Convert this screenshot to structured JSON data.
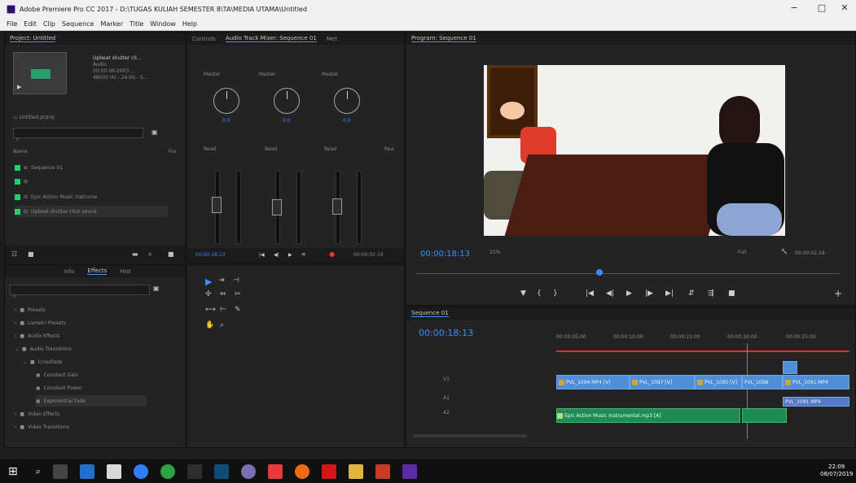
{
  "window": {
    "title": "Adobe Premiere Pro CC 2017 - D:\\TUGAS KULIAH SEMESTER 8\\TA\\MEDIA UTAMA\\Untitled",
    "minimize": "−",
    "maximize": "□",
    "close": "✕"
  },
  "menu": [
    "File",
    "Edit",
    "Clip",
    "Sequence",
    "Marker",
    "Title",
    "Window",
    "Help"
  ],
  "project": {
    "tab": "Project: Untitled",
    "clip_name": "Upbeat shutter cli...",
    "clip_type": "Audio",
    "clip_duration": "00:00:06:2003 ...",
    "clip_rate": "48000 Hz - 24 bit - S...",
    "project_file": "Untitled.prproj",
    "header_name": "Name",
    "header_fps": "Fra",
    "items": [
      "Sequence 01",
      "",
      "Epic Action Music Instrume",
      "Upbeat shutter click sound"
    ]
  },
  "mixer": {
    "tabs": [
      "Controls",
      "Audio Track Mixer: Sequence 01",
      "Met"
    ],
    "track_labels": [
      "Master",
      "Master",
      "Master"
    ],
    "read_labels": [
      "Read",
      "Read",
      "Read",
      "Rea"
    ],
    "knob_values": [
      "0.0",
      "0.0",
      "0.0"
    ],
    "time_left": "00:00:18:13",
    "time_right": "00:00:02:19"
  },
  "effects": {
    "tabs": [
      "Info",
      "Effects",
      "Hist"
    ],
    "search_placeholder": "",
    "folders": [
      "Presets",
      "Lumetri Presets",
      "Audio Effects",
      "Audio Transitions",
      "Crossfade",
      "Constant Gain",
      "Constant Power",
      "Exponential Fade",
      "Video Effects",
      "Video Transitions"
    ]
  },
  "program": {
    "tab": "Program: Sequence 01",
    "timecode": "00:00:18:13",
    "zoom": "25%",
    "quality": "Full",
    "duration": "00:00:02:19"
  },
  "timeline": {
    "tab": "Sequence 01",
    "timecode": "00:00:18:13",
    "ticks": [
      "00:00:05:00",
      "00:00:10:00",
      "00:00:15:00",
      "00:00:20:00",
      "00:00:25:00"
    ],
    "tracks": [
      "V1",
      "A1",
      "A2"
    ],
    "clips": [
      "PVL_1094.MP4 [V]",
      "PVL_1097 [V]",
      "PVL_1095 [V]",
      "PVL_1098",
      "PVL_1091.MP4"
    ],
    "audio_label": "Epic Action Music Instrumental.mp3 [A]",
    "a2_label": "PVL_1091.MP4"
  },
  "taskbar": {
    "time": "22:09",
    "date": "08/07/2019"
  }
}
